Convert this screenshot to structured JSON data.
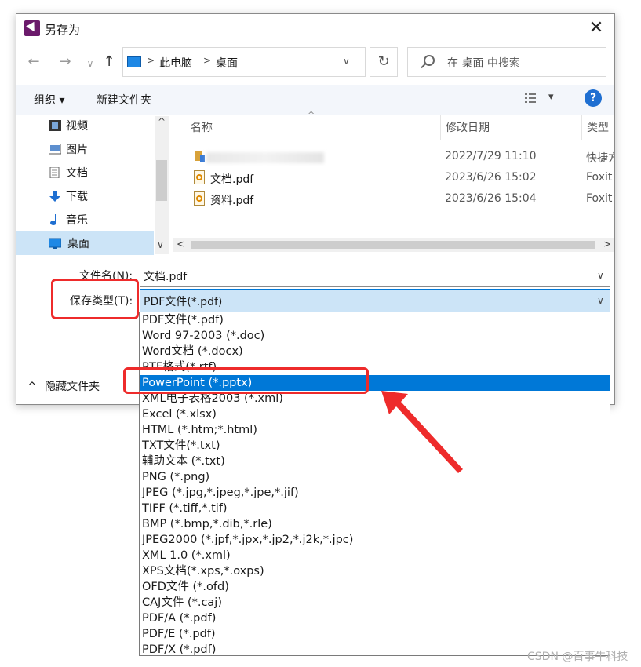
{
  "dialog": {
    "title": "另存为",
    "close_glyph": "✕",
    "nav": {
      "back": "←",
      "forward": "→",
      "recent": "∨",
      "up": "↑"
    },
    "address": {
      "root": "此电脑",
      "sep": ">",
      "current": "桌面",
      "dropdown": "∨"
    },
    "refresh_glyph": "↻",
    "search_placeholder": "在 桌面 中搜索"
  },
  "toolbar": {
    "organize": "组织 ▾",
    "new_folder": "新建文件夹",
    "view_dropdown": "▾",
    "help": "?"
  },
  "sidebar": {
    "items": [
      {
        "label": "视频",
        "icon": "video-icon"
      },
      {
        "label": "图片",
        "icon": "picture-icon"
      },
      {
        "label": "文档",
        "icon": "document-icon"
      },
      {
        "label": "下载",
        "icon": "download-icon"
      },
      {
        "label": "音乐",
        "icon": "music-icon"
      },
      {
        "label": "桌面",
        "icon": "desktop-icon",
        "selected": true
      }
    ],
    "scroll_up": "^",
    "scroll_down": "∨"
  },
  "file_list": {
    "columns": {
      "name": "名称",
      "modified": "修改日期",
      "type": "类型",
      "sort_glyph": "^"
    },
    "rows": [
      {
        "name": "",
        "date": "2022/7/29 11:10",
        "type": "快捷方式",
        "icon": "shortcut-icon"
      },
      {
        "name": "文档.pdf",
        "date": "2023/6/26 15:02",
        "type": "Foxit",
        "icon": "pdf-file-icon"
      },
      {
        "name": "资料.pdf",
        "date": "2023/6/26 15:04",
        "type": "Foxit",
        "icon": "pdf-file-icon"
      }
    ],
    "scroll_left": "<",
    "scroll_right": ">"
  },
  "form": {
    "filename_label": "文件名(N):",
    "filename_value": "文档.pdf",
    "type_label": "保存类型(T):",
    "type_value": "PDF文件(*.pdf)",
    "dropdown_glyph": "∨"
  },
  "hide_folders": {
    "glyph": "^",
    "label": "隐藏文件夹"
  },
  "type_options": [
    "PDF文件(*.pdf)",
    "Word 97-2003 (*.doc)",
    "Word文档 (*.docx)",
    "RTF格式(*.rtf)",
    "PowerPoint (*.pptx)",
    "XML电子表格2003 (*.xml)",
    "Excel (*.xlsx)",
    "HTML (*.htm;*.html)",
    "TXT文件(*.txt)",
    "辅助文本 (*.txt)",
    "PNG (*.png)",
    "JPEG (*.jpg,*.jpeg,*.jpe,*.jif)",
    "TIFF (*.tiff,*.tif)",
    "BMP (*.bmp,*.dib,*.rle)",
    "JPEG2000 (*.jpf,*.jpx,*.jp2,*.j2k,*.jpc)",
    "XML 1.0 (*.xml)",
    "XPS文档(*.xps,*.oxps)",
    "OFD文件 (*.ofd)",
    "CAJ文件 (*.caj)",
    "PDF/A (*.pdf)",
    "PDF/E (*.pdf)",
    "PDF/X (*.pdf)"
  ],
  "selected_option_index": 4,
  "watermark": "CSDN @百事牛科技",
  "colors": {
    "accent": "#0078d7",
    "highlight": "#cce4f7",
    "annotation": "#ee2b2b"
  }
}
